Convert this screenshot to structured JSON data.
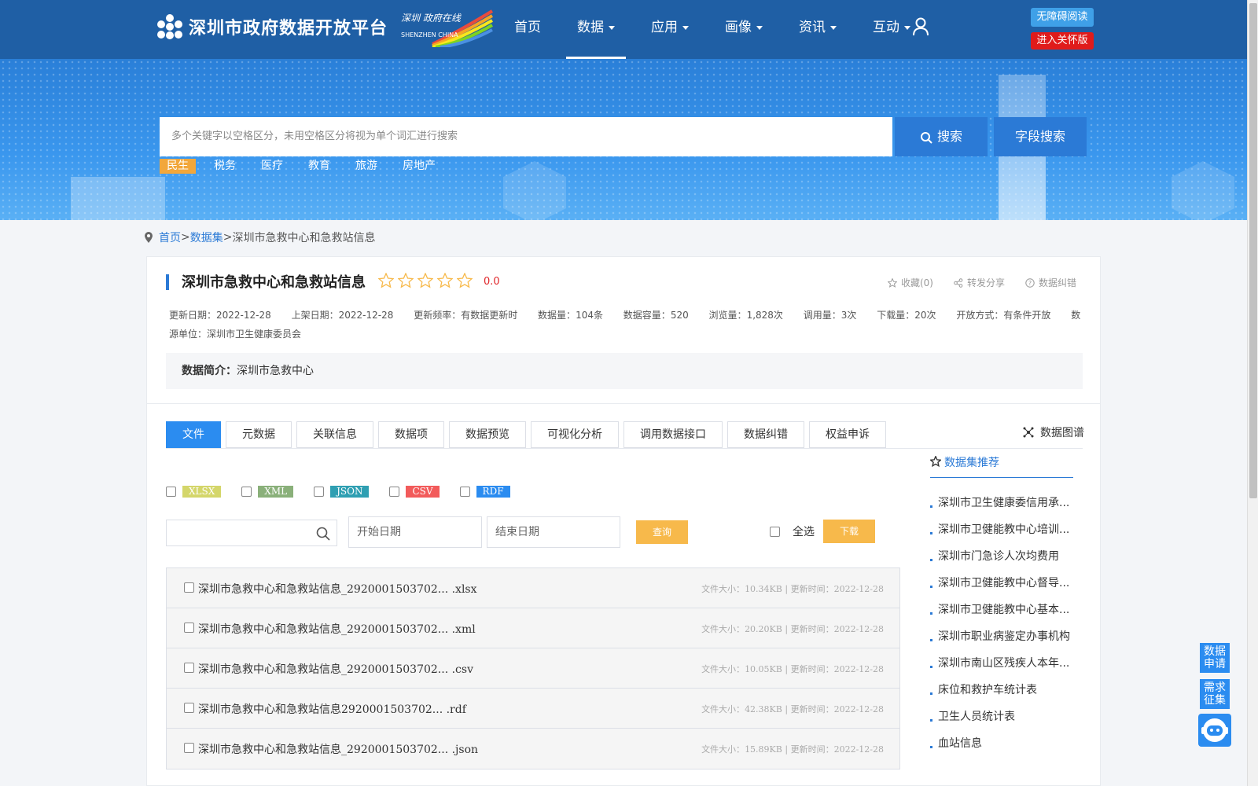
{
  "header": {
    "site_title": "深圳市政府数据开放平台",
    "sz_logo_text": "深圳 政府在线",
    "sz_logo_sub": "SHENZHEN CHINA",
    "nav": [
      {
        "label": "首页",
        "has_caret": false,
        "active": false
      },
      {
        "label": "数据",
        "has_caret": true,
        "active": true
      },
      {
        "label": "应用",
        "has_caret": true,
        "active": false
      },
      {
        "label": "画像",
        "has_caret": true,
        "active": false
      },
      {
        "label": "资讯",
        "has_caret": true,
        "active": false
      },
      {
        "label": "互动",
        "has_caret": true,
        "active": false
      }
    ],
    "accessibility_label": "无障碍阅读",
    "care_mode_label": "进入关怀版"
  },
  "search": {
    "placeholder": "多个关键字以空格区分，未用空格区分将视为单个词汇进行搜索",
    "search_label": "搜索",
    "field_search_label": "字段搜索",
    "tags": [
      "民生",
      "税务",
      "医疗",
      "教育",
      "旅游",
      "房地产"
    ]
  },
  "breadcrumb": {
    "home": "首页",
    "sep1": ">",
    "datasets": "数据集",
    "sep2": ">",
    "current": "深圳市急救中心和急救站信息"
  },
  "dataset": {
    "title": "深圳市急救中心和急救站信息",
    "rating": "0.0",
    "rating_value": 0,
    "actions": {
      "favorite": "收藏(0)",
      "share": "转发分享",
      "correct": "数据纠错"
    },
    "meta": [
      {
        "key": "更新日期：",
        "value": "2022-12-28"
      },
      {
        "key": "上架日期：",
        "value": "2022-12-28"
      },
      {
        "key": "更新频率：",
        "value": "有数据更新时"
      },
      {
        "key": "数据量：",
        "value": "104条"
      },
      {
        "key": "数据容量：",
        "value": "520"
      },
      {
        "key": "浏览量：",
        "value": "1,828次"
      },
      {
        "key": "调用量：",
        "value": "3次"
      },
      {
        "key": "下载量：",
        "value": "20次"
      },
      {
        "key": "开放方式：",
        "value": "有条件开放"
      },
      {
        "key": "数源单位：",
        "value": "深圳市卫生健康委员会"
      }
    ],
    "intro_label": "数据简介：",
    "intro_text": "深圳市急救中心"
  },
  "tabs": [
    "文件",
    "元数据",
    "关联信息",
    "数据项",
    "数据预览",
    "可视化分析",
    "调用数据接口",
    "数据纠错",
    "权益申诉"
  ],
  "graph_label": "数据图谱",
  "formats": [
    {
      "label": "XLSX",
      "color": "#d4d66a"
    },
    {
      "label": "XML",
      "color": "#8ab07a"
    },
    {
      "label": "JSON",
      "color": "#2f9fb2"
    },
    {
      "label": "CSV",
      "color": "#f25b5b"
    },
    {
      "label": "RDF",
      "color": "#2b8cf0"
    }
  ],
  "query": {
    "start_placeholder": "开始日期",
    "end_placeholder": "结束日期",
    "query_label": "查询",
    "select_all_label": "全选",
    "download_label": "下载"
  },
  "files": [
    {
      "name": "深圳市急救中心和急救站信息_2920001503702... .xlsx",
      "size_key": "文件大小：",
      "size": "10.34KB",
      "sep": "|",
      "time_key": "更新时间：",
      "time": "2022-12-28"
    },
    {
      "name": "深圳市急救中心和急救站信息_2920001503702... .xml",
      "size_key": "文件大小：",
      "size": "20.20KB",
      "sep": "|",
      "time_key": "更新时间：",
      "time": "2022-12-28"
    },
    {
      "name": "深圳市急救中心和急救站信息_2920001503702... .csv",
      "size_key": "文件大小：",
      "size": "10.05KB",
      "sep": "|",
      "time_key": "更新时间：",
      "time": "2022-12-28"
    },
    {
      "name": "深圳市急救中心和急救站信息2920001503702... .rdf",
      "size_key": "文件大小：",
      "size": "42.38KB",
      "sep": "|",
      "time_key": "更新时间：",
      "time": "2022-12-28"
    },
    {
      "name": "深圳市急救中心和急救站信息_2920001503702... .json",
      "size_key": "文件大小：",
      "size": "15.89KB",
      "sep": "|",
      "time_key": "更新时间：",
      "time": "2022-12-28"
    }
  ],
  "recommend": {
    "title": "数据集推荐",
    "items": [
      "深圳市卫生健康委信用承...",
      "深圳市卫健能教中心培训...",
      "深圳市门急诊人次均费用",
      "深圳市卫健能教中心督导...",
      "深圳市卫健能教中心基本...",
      "深圳市职业病鉴定办事机构",
      "深圳市南山区残疾人本年...",
      "床位和救护车统计表",
      "卫生人员统计表",
      "血站信息"
    ]
  },
  "floats": {
    "apply": "数据申请",
    "demand": "需求征集"
  },
  "colors": {
    "header": "#1f5fa5",
    "accent": "#2b7ad6",
    "tab_active": "#2b8cf0",
    "orange": "#f7b94b",
    "red": "#e01b1b"
  }
}
